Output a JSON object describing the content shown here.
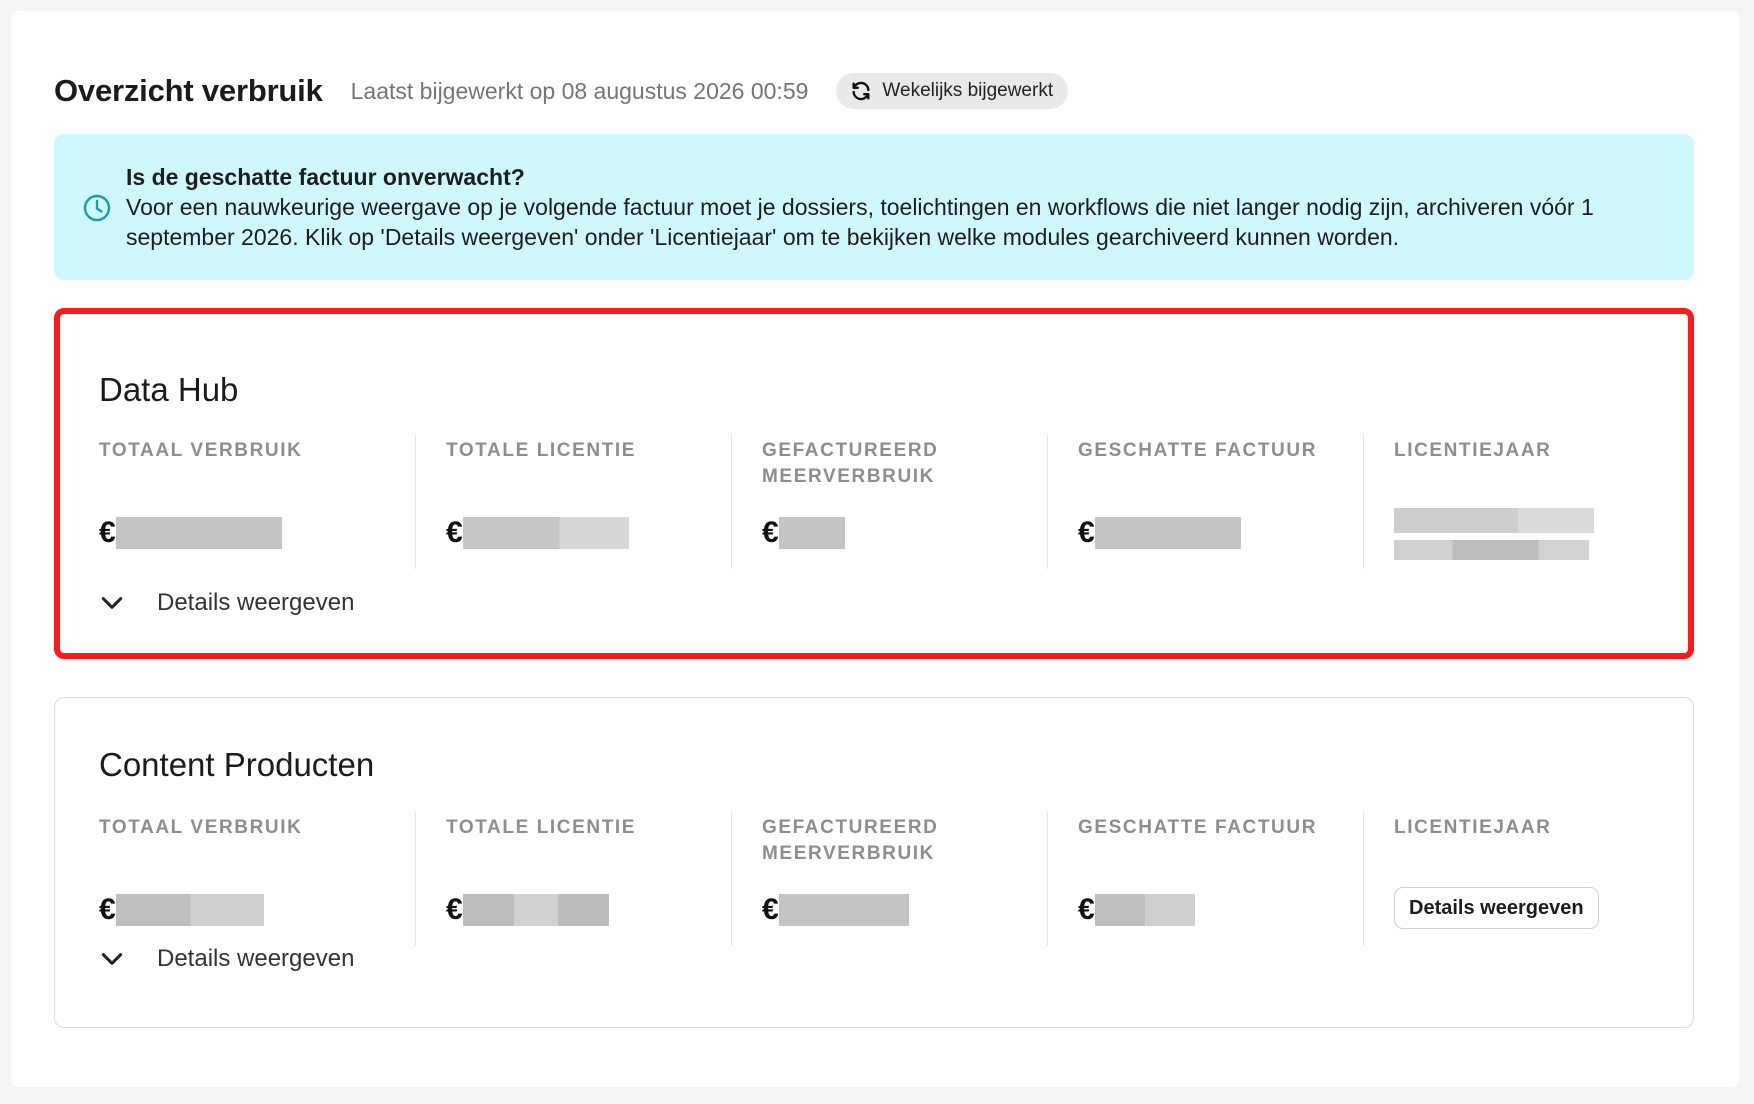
{
  "header": {
    "title": "Overzicht verbruik",
    "updated": "Laatst bijgewerkt op 08 augustus 2026 00:59",
    "badge": "Wekelijks bijgewerkt"
  },
  "alert": {
    "title": "Is de geschatte factuur onverwacht?",
    "body": "Voor een nauwkeurige weergave op je volgende factuur moet je dossiers, toelichtingen en workflows die niet langer nodig zijn, archiveren vóór 1 september 2026. Klik op 'Details weergeven' onder 'Licentiejaar' om te bekijken welke modules gearchiveerd kunnen worden."
  },
  "columns": {
    "totaal_verbruik": "TOTAAL VERBRUIK",
    "totale_licentie": "TOTALE LICENTIE",
    "gefactureerd": "GEFACTUREERD MEERVERBRUIK",
    "geschatte_factuur": "GESCHATTE FACTUUR",
    "licentiejaar": "LICENTIEJAAR"
  },
  "currency": "€",
  "cards": [
    {
      "title": "Data Hub",
      "details_label": "Details weergeven"
    },
    {
      "title": "Content Producten",
      "details_label": "Details weergeven",
      "year_button": "Details weergeven"
    }
  ],
  "colors": {
    "alert_bg": "#cff8fd",
    "highlight_border": "#ff1a1a",
    "accent_icon": "#1a9bb5"
  },
  "icons": {
    "refresh": "refresh-icon",
    "clock": "clock-icon",
    "chevron": "chevron-down-icon"
  }
}
